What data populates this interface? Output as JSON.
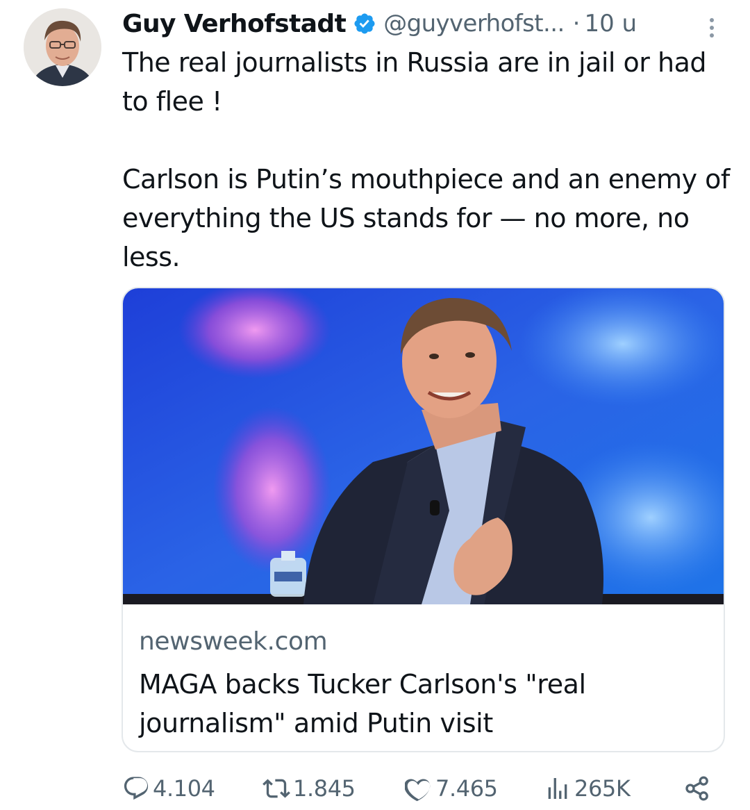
{
  "tweet": {
    "author_name": "Guy Verhofstadt",
    "handle": "@guyverhofst...",
    "separator": "·",
    "time": "10 u",
    "text_lines": [
      "The real journalists in Russia are in jail or had to flee !",
      "Carlson is Putin’s mouthpiece and an enemy of everything the US stands for — no more, no less."
    ]
  },
  "card": {
    "domain": "newsweek.com",
    "title": "MAGA backs Tucker Carlson's \"real journalism\" amid Putin visit"
  },
  "actions": {
    "replies": "4.104",
    "retweets": "1.845",
    "likes": "7.465",
    "views": "265K"
  },
  "icons": {
    "verified": "verified-badge-icon",
    "more": "more-options-icon",
    "reply": "reply-icon",
    "retweet": "retweet-icon",
    "like": "heart-icon",
    "views": "views-icon",
    "share": "share-icon"
  },
  "colors": {
    "verified": "#1d9bf0",
    "secondary_text": "#536471",
    "card_border": "#e4e8eb"
  }
}
